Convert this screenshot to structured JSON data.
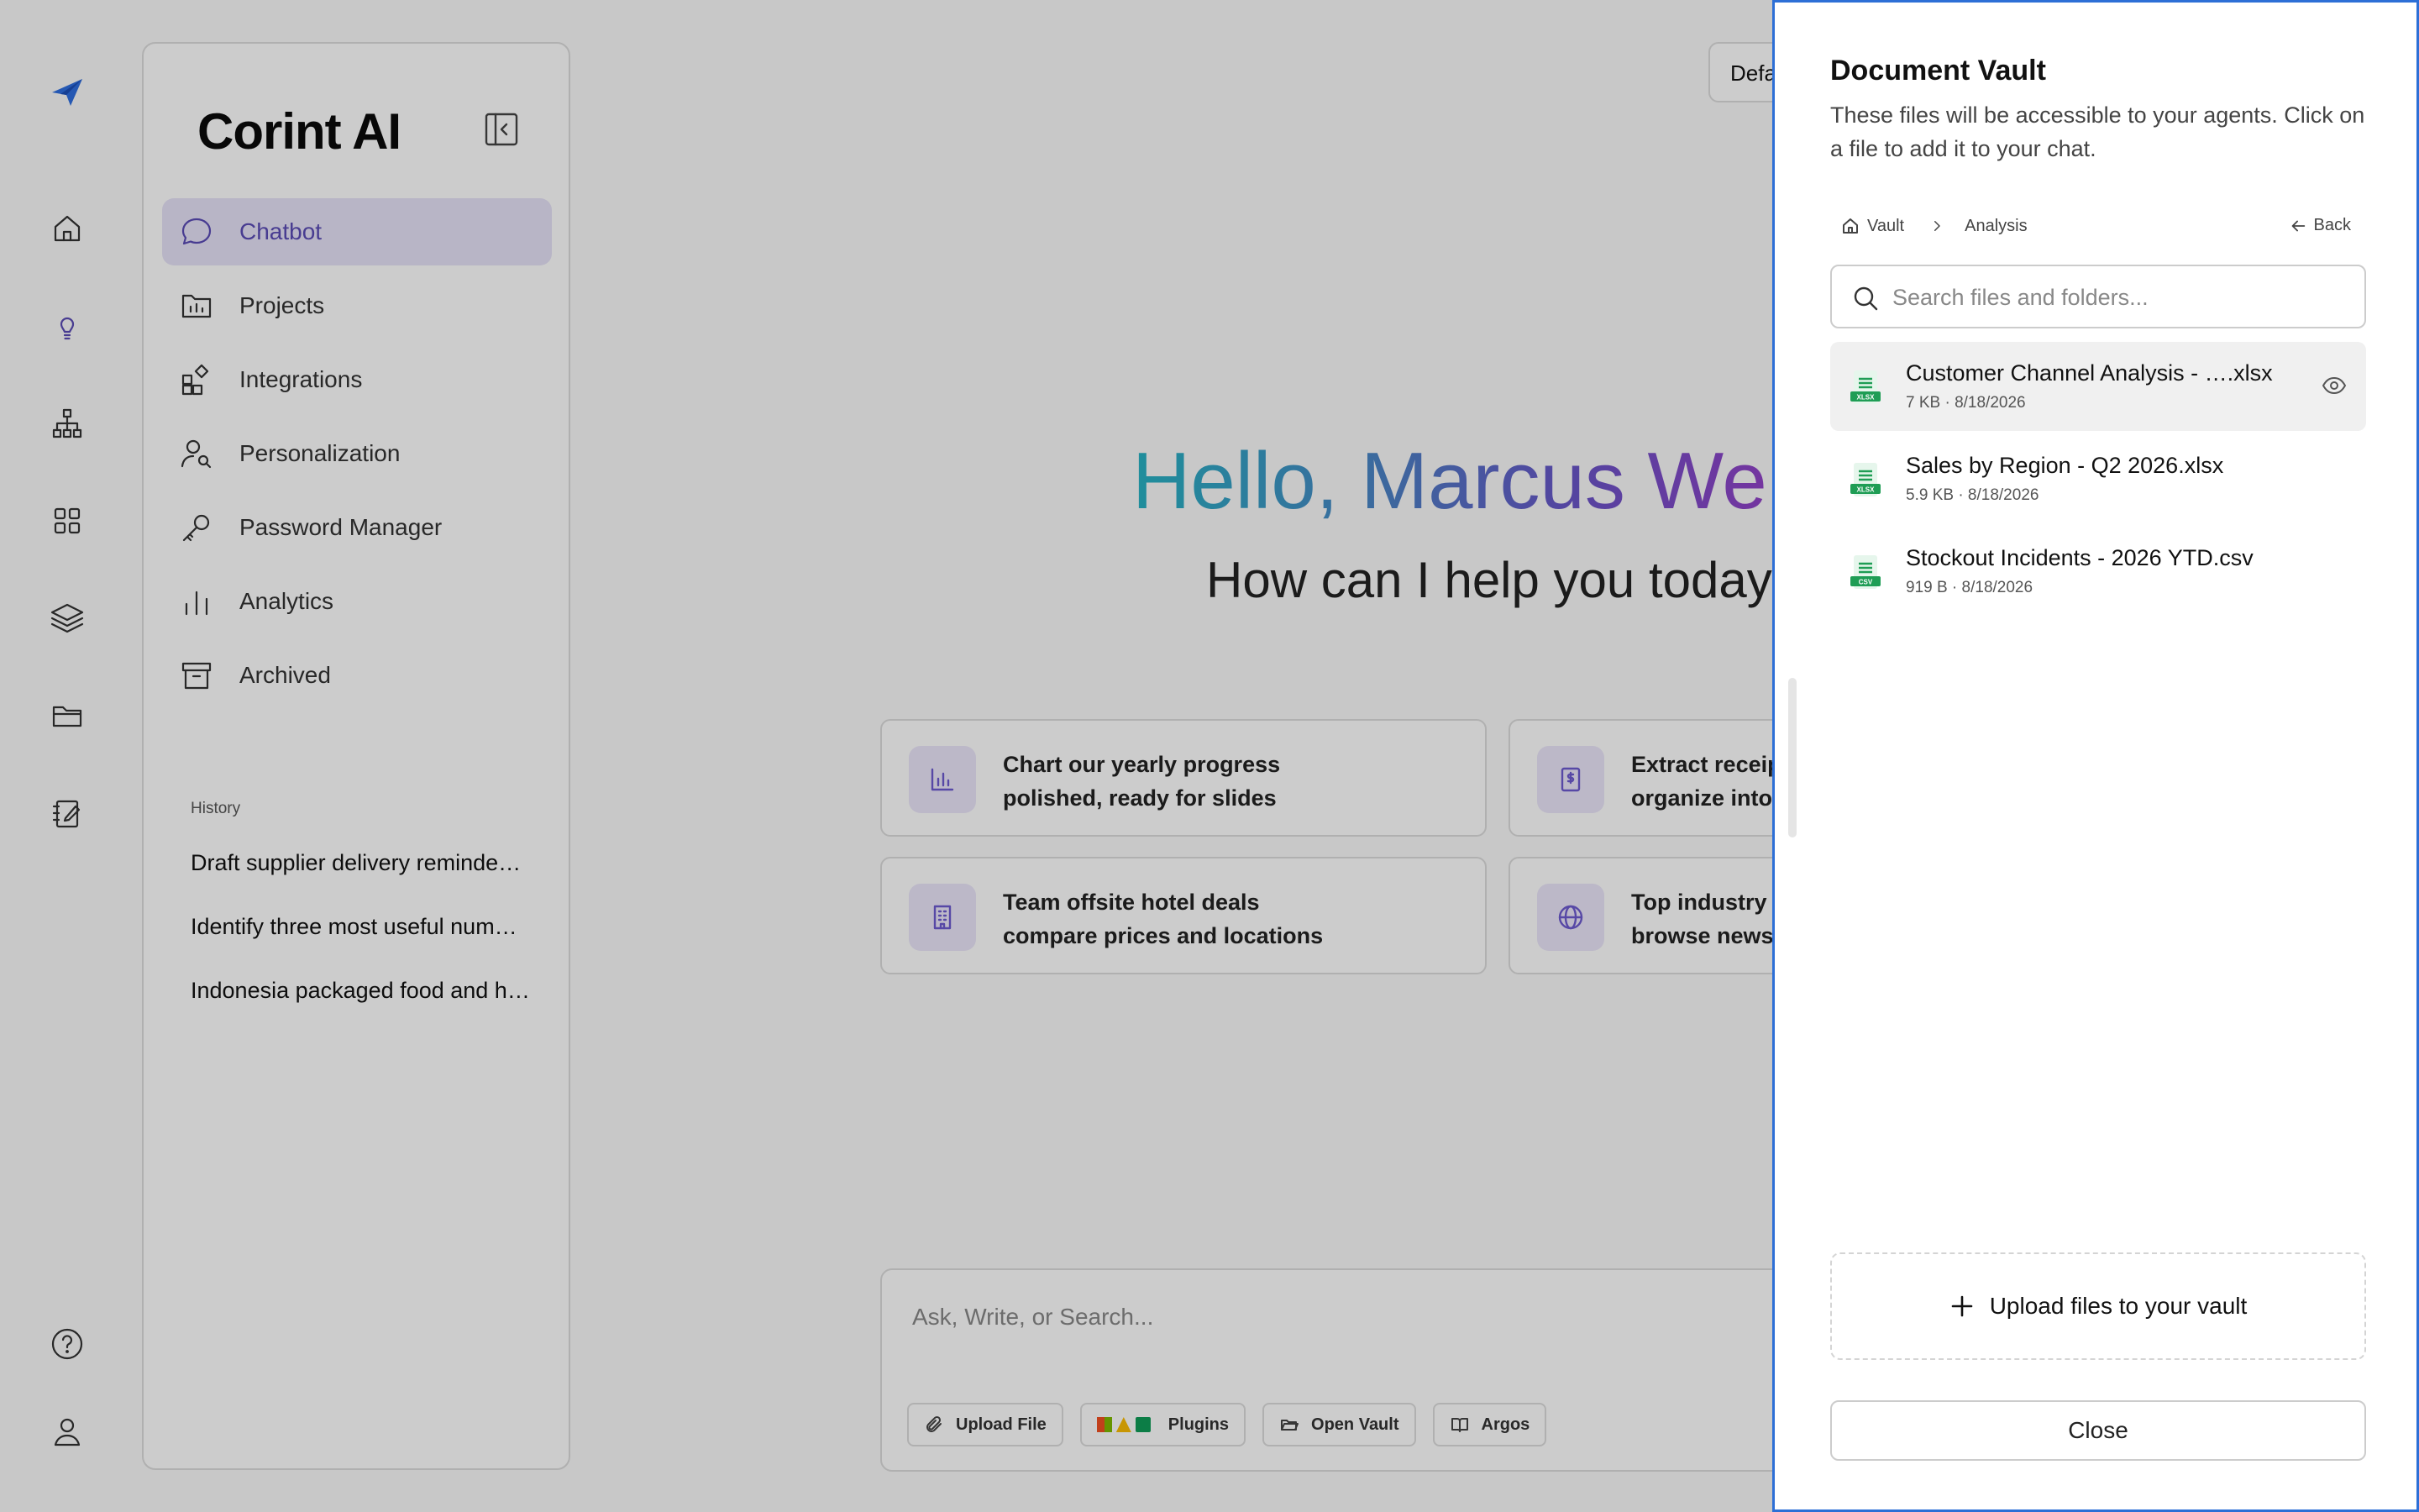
{
  "sidebar": {
    "brand": "Corint AI",
    "items": [
      {
        "label": "Chatbot",
        "icon": "chat-bubble-icon"
      },
      {
        "label": "Projects",
        "icon": "folder-chart-icon"
      },
      {
        "label": "Integrations",
        "icon": "integrations-icon"
      },
      {
        "label": "Personalization",
        "icon": "user-search-icon"
      },
      {
        "label": "Password Manager",
        "icon": "key-icon"
      },
      {
        "label": "Analytics",
        "icon": "bar-chart-icon"
      },
      {
        "label": "Archived",
        "icon": "archive-icon"
      }
    ],
    "history_title": "History",
    "history": [
      "Draft supplier delivery reminde…",
      "Identify three most useful num…",
      "Indonesia packaged food and h…"
    ]
  },
  "rail": {
    "icons": [
      "logo-icon",
      "home-icon",
      "lightbulb-icon",
      "hierarchy-icon",
      "apps-grid-icon",
      "layers-icon",
      "folder-icon",
      "notebook-icon",
      "help-icon",
      "user-icon"
    ]
  },
  "main": {
    "top_pill": "Defa",
    "greeting": "Hello, Marcus Web",
    "subtitle": "How can I help you today",
    "cards": [
      {
        "line1": "Chart our yearly progress",
        "line2": "polished, ready for slides",
        "icon": "bar-chart-icon"
      },
      {
        "line1": "Extract receip",
        "line2": "organize into",
        "icon": "receipt-icon"
      },
      {
        "line1": "Team offsite hotel deals",
        "line2": "compare prices and locations",
        "icon": "building-icon"
      },
      {
        "line1": "Top industry",
        "line2": "browse news",
        "icon": "globe-icon"
      }
    ],
    "composer": {
      "placeholder": "Ask, Write, or Search...",
      "tools": {
        "upload": "Upload File",
        "plugins": "Plugins",
        "vault": "Open Vault",
        "argos": "Argos"
      }
    }
  },
  "vault": {
    "title": "Document Vault",
    "description": "These files will be accessible to your agents. Click on a file to add it to your chat.",
    "breadcrumb": {
      "root": "Vault",
      "current": "Analysis"
    },
    "back_label": "Back",
    "search_placeholder": "Search files and folders...",
    "files": [
      {
        "name": "Customer Channel Analysis - ….xlsx",
        "meta": "7 KB · 8/18/2026",
        "type": "XLSX"
      },
      {
        "name": "Sales by Region - Q2 2026.xlsx",
        "meta": "5.9 KB · 8/18/2026",
        "type": "XLSX"
      },
      {
        "name": "Stockout Incidents - 2026 YTD.csv",
        "meta": "919 B · 8/18/2026",
        "type": "CSV"
      }
    ],
    "upload_label": "Upload files to your vault",
    "close_label": "Close"
  },
  "colors": {
    "accent": "#5b4bb6",
    "panel_border": "#2d6fd6",
    "spreadsheet_green": "#1f9d55"
  }
}
